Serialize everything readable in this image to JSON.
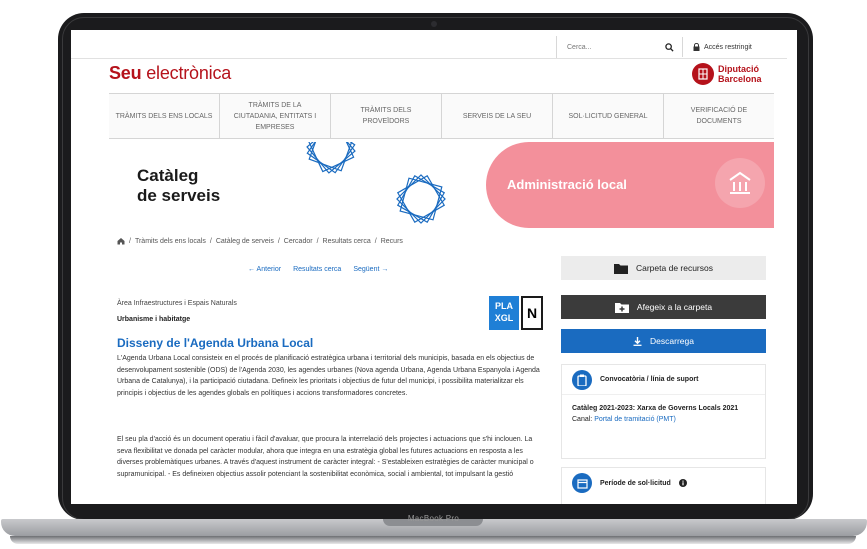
{
  "device": {
    "label": "MacBook Pro"
  },
  "header": {
    "search_placeholder": "Cerca...",
    "access_label": "Accés restringit",
    "logo_bold": "Seu",
    "logo_rest": " electrònica",
    "diba_line1": "Diputació",
    "diba_line2": "Barcelona"
  },
  "nav": {
    "items": [
      {
        "label": "Tràmits dels ens locals"
      },
      {
        "label": "Tràmits de la ciutadania, entitats i empreses"
      },
      {
        "label": "Tràmits dels proveïdors"
      },
      {
        "label": "Serveis de la seu"
      },
      {
        "label": "Sol·licitud general"
      },
      {
        "label": "Verificació de documents"
      }
    ]
  },
  "hero": {
    "title_line1": "Catàleg",
    "title_line2": "de serveis",
    "section_label": "Administració local"
  },
  "breadcrumb": {
    "items": [
      "Tràmits dels ens locals",
      "Catàleg de serveis",
      "Cercador",
      "Resultats cerca",
      "Recurs"
    ],
    "sep": "/"
  },
  "pager": {
    "prev": "← Anterior",
    "results": "Resultats cerca",
    "next": "Següent →"
  },
  "content": {
    "area": "Àrea Infraestructures i Espais Naturals",
    "theme": "Urbanisme i habitatge",
    "badge_line1": "PLA",
    "badge_line2": "XGL",
    "badge_n": "N",
    "title": "Disseny de l'Agenda Urbana Local",
    "p1": "L'Agenda Urbana Local consisteix en el procés de planificació estratègica urbana i territorial dels municipis, basada en els objectius de desenvolupament sostenible (ODS) de l'Agenda 2030, les agendes urbanes (Nova agenda Urbana, Agenda Urbana Espanyola i Agenda Urbana de Catalunya), i la participació ciutadana. Defineix les prioritats i objectius de futur del municipi, i possibilita materialitzar els principis i objectius de les agendes globals en polítiques i accions transformadores concretes.",
    "p2": "El seu pla d'acció és un document operatiu i fàcil d'avaluar, que procura la interrelació dels projectes i actuacions que s'hi inclouen. La seva flexibilitat ve donada pel caràcter modular, ahora que integra en una estratègia global les futures actuacions en resposta a les diverses problemàtiques urbanes. A través d'aquest instrument de caràcter integral: - S'estableixen estratègies de caràcter municipal o supramunicipal. - Es defineixen objectius assolir potenciant la sostenibilitat econòmica, social i ambiental, tot impulsant la gestió"
  },
  "sidebar": {
    "carpeta": "Carpeta de recursos",
    "afegeix": "Afegeix a la carpeta",
    "descarrega": "Descarrega",
    "card1_title": "Convocatòria / línia de suport",
    "card1_name": "Catàleg 2021-2023: Xarxa de Governs Locals 2021",
    "card1_canal_label": "Canal:",
    "card1_canal_link": "Portal de tramitació (PMT)",
    "card2_title": "Període de sol·licitud"
  },
  "colors": {
    "brand_red": "#b5121b",
    "link_blue": "#1a6bc0",
    "hero_pink": "#f3909b"
  }
}
